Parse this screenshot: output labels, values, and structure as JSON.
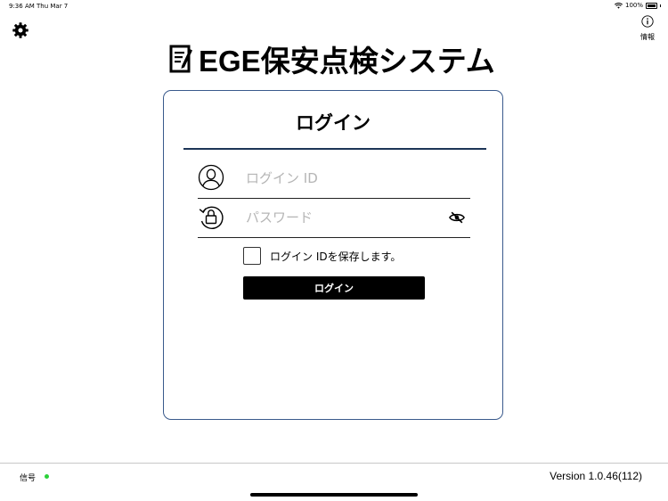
{
  "status_bar": {
    "time": "9:36 AM",
    "date": "Thu Mar 7",
    "battery": "100%"
  },
  "header": {
    "settings_icon": "gear-icon",
    "info_label": "情報",
    "info_icon": "info-circle-icon"
  },
  "app": {
    "title": "EGE保安点検システム",
    "title_icon": "clipboard-pen-icon"
  },
  "login": {
    "title": "ログイン",
    "id_placeholder": "ログイン ID",
    "password_placeholder": "パスワード",
    "save_id_label": "ログイン IDを保存します。",
    "save_id_checked": false,
    "button_label": "ログイン"
  },
  "footer": {
    "signal_label": "信号",
    "signal_color": "#2bd13a",
    "version": "Version 1.0.46(112)"
  },
  "colors": {
    "card_border": "#3a5a8c",
    "divider": "#1d3557",
    "button": "#000000"
  }
}
